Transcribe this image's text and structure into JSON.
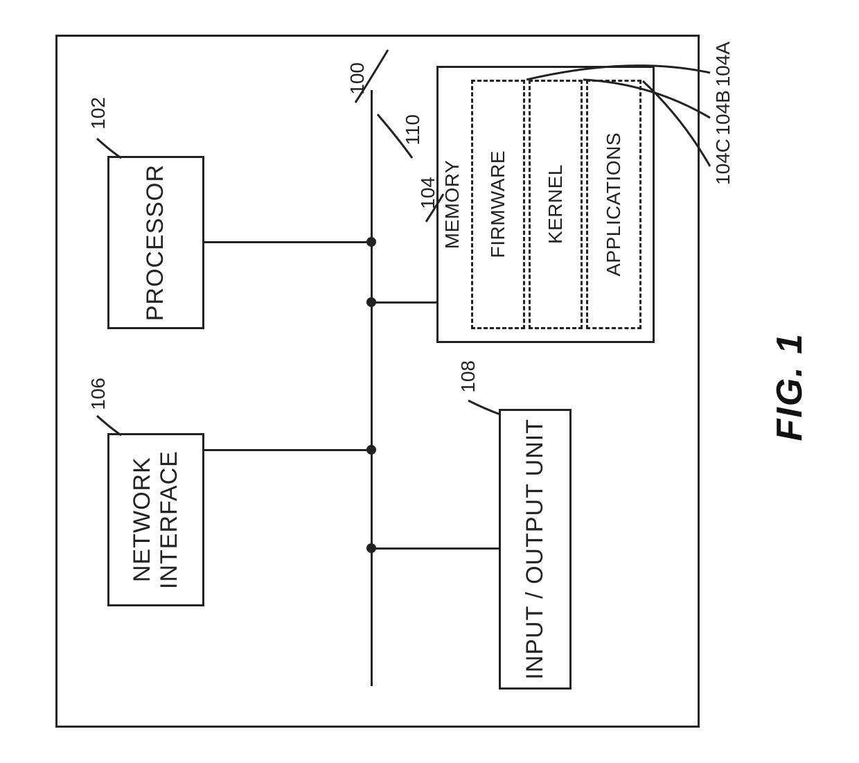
{
  "figure": {
    "title": "FIG. 1",
    "outer_ref": "100",
    "bus_ref": "110"
  },
  "blocks": {
    "processor": {
      "label": "PROCESSOR",
      "ref": "102"
    },
    "memory": {
      "label": "MEMORY",
      "ref": "104",
      "firmware": {
        "label": "FIRMWARE",
        "ref": "104A"
      },
      "kernel": {
        "label": "KERNEL",
        "ref": "104B"
      },
      "applications": {
        "label": "APPLICATIONS",
        "ref": "104C"
      }
    },
    "network": {
      "label": "NETWORK INTERFACE",
      "ref": "106"
    },
    "io": {
      "label": "INPUT / OUTPUT UNIT",
      "ref": "108"
    }
  }
}
